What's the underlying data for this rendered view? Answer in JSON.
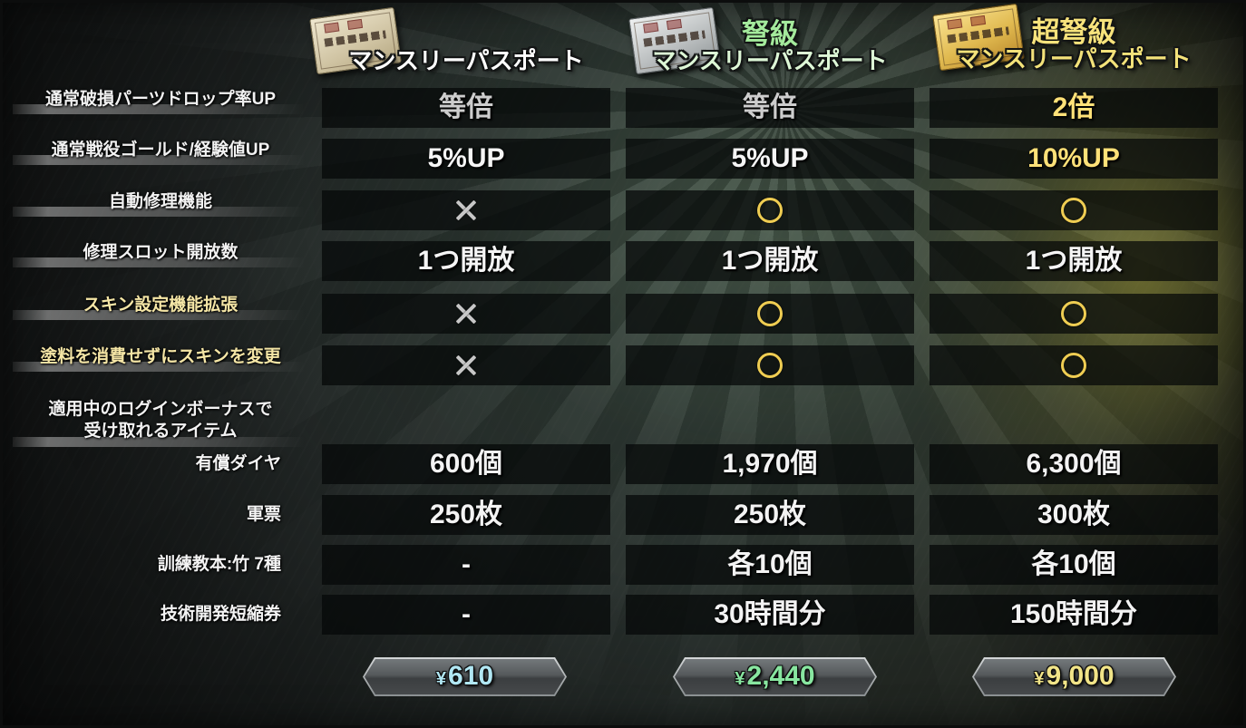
{
  "colors": {
    "cell_text": "#f3f3f3",
    "circle_mark": "#efcd52",
    "cross_mark": "#c7c7c7"
  },
  "tiers": [
    {
      "name": "マンスリーパスポート",
      "title_color": "#ffffff",
      "price": {
        "currency": "¥",
        "amount": "610"
      },
      "price_color": "#b1e7f3"
    },
    {
      "grade": "弩級",
      "grade_color": "#a4ea9c",
      "name": "マンスリーパスポート",
      "title_color": "#ddf7d6",
      "price": {
        "currency": "¥",
        "amount": "2,440"
      },
      "price_color": "#88e6a0"
    },
    {
      "grade": "超弩級",
      "grade_color": "#f7e37c",
      "name": "マンスリーパスポート",
      "title_color": "#f3e27a",
      "price": {
        "currency": "¥",
        "amount": "9,000"
      },
      "price_color": "#f1e488"
    }
  ],
  "features": [
    {
      "label": "通常破損パーツドロップ率UP",
      "label_color": "#f2f2f2",
      "values": [
        {
          "text": "等倍",
          "color": "#cdcdcd"
        },
        {
          "text": "等倍",
          "color": "#cdcdcd"
        },
        {
          "text": "2倍",
          "color": "#ffe178"
        }
      ]
    },
    {
      "label": "通常戦役ゴールド/経験値UP",
      "label_color": "#f2f2f2",
      "values": [
        {
          "text": "5%UP",
          "color": "#f5f5f5"
        },
        {
          "text": "5%UP",
          "color": "#f5f5f5"
        },
        {
          "text": "10%UP",
          "color": "#ffe178"
        }
      ]
    },
    {
      "label": "自動修理機能",
      "label_color": "#f2f2f2",
      "values": [
        {
          "icon": "cross-mark-icon"
        },
        {
          "icon": "circle-mark-icon"
        },
        {
          "icon": "circle-mark-icon"
        }
      ]
    },
    {
      "label": "修理スロット開放数",
      "label_color": "#f2f2f2",
      "values": [
        {
          "text": "1つ開放",
          "color": "#f5f5f5"
        },
        {
          "text": "1つ開放",
          "color": "#f5f5f5"
        },
        {
          "text": "1つ開放",
          "color": "#f5f5f5"
        }
      ]
    },
    {
      "label": "スキン設定機能拡張",
      "label_color": "#f5e6a6",
      "values": [
        {
          "icon": "cross-mark-icon"
        },
        {
          "icon": "circle-mark-icon"
        },
        {
          "icon": "circle-mark-icon"
        }
      ]
    },
    {
      "label": "塗料を消費せずにスキンを変更",
      "label_color": "#f5e6a6",
      "values": [
        {
          "icon": "cross-mark-icon"
        },
        {
          "icon": "circle-mark-icon"
        },
        {
          "icon": "circle-mark-icon"
        }
      ]
    }
  ],
  "bonus": {
    "heading_line1": "適用中のログインボーナスで",
    "heading_line2": "受け取れるアイテム",
    "items": [
      {
        "label": "有償ダイヤ",
        "values": [
          "600個",
          "1,970個",
          "6,300個"
        ]
      },
      {
        "label": "軍票",
        "values": [
          "250枚",
          "250枚",
          "300枚"
        ]
      },
      {
        "label": "訓練教本:竹 7種",
        "values": [
          "-",
          "各10個",
          "各10個"
        ]
      },
      {
        "label": "技術開発短縮券",
        "values": [
          "-",
          "30時間分",
          "150時間分"
        ]
      }
    ]
  }
}
